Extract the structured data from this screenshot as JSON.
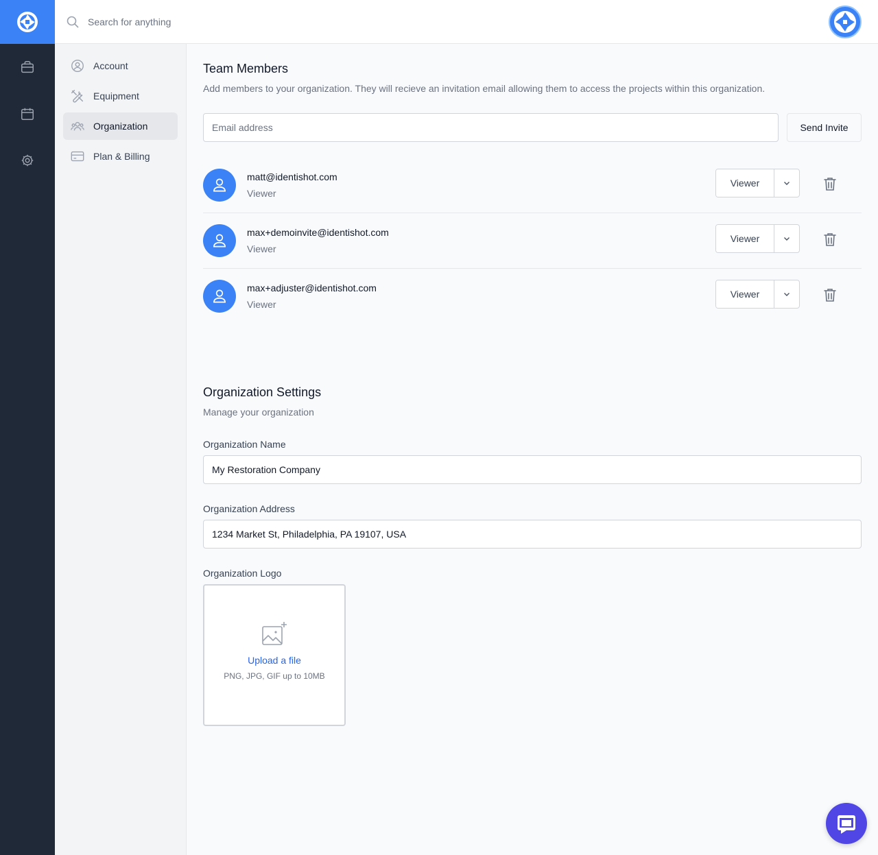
{
  "search": {
    "placeholder": "Search for anything"
  },
  "subnav": {
    "items": [
      {
        "label": "Account",
        "icon": "user-circle-icon",
        "active": false
      },
      {
        "label": "Equipment",
        "icon": "wrench-screwdriver-icon",
        "active": false
      },
      {
        "label": "Organization",
        "icon": "user-group-icon",
        "active": true
      },
      {
        "label": "Plan & Billing",
        "icon": "credit-card-icon",
        "active": false
      }
    ]
  },
  "team": {
    "title": "Team Members",
    "description": "Add members to your organization. They will recieve an invitation email allowing them to access the projects within this organization.",
    "email_placeholder": "Email address",
    "send_label": "Send Invite",
    "members": [
      {
        "email": "matt@identishot.com",
        "role": "Viewer",
        "role_button": "Viewer"
      },
      {
        "email": "max+demoinvite@identishot.com",
        "role": "Viewer",
        "role_button": "Viewer"
      },
      {
        "email": "max+adjuster@identishot.com",
        "role": "Viewer",
        "role_button": "Viewer"
      }
    ]
  },
  "org": {
    "title": "Organization Settings",
    "description": "Manage your organization",
    "name_label": "Organization Name",
    "name_value": "My Restoration Company",
    "address_label": "Organization Address",
    "address_value": "1234 Market St, Philadelphia, PA 19107, USA",
    "logo_label": "Organization Logo",
    "upload_link": "Upload a file",
    "upload_hint": "PNG, JPG, GIF up to 10MB"
  },
  "colors": {
    "accent": "#3b82f6",
    "rail": "#1f2937",
    "link": "#2563eb",
    "chat": "#4f46e5"
  }
}
